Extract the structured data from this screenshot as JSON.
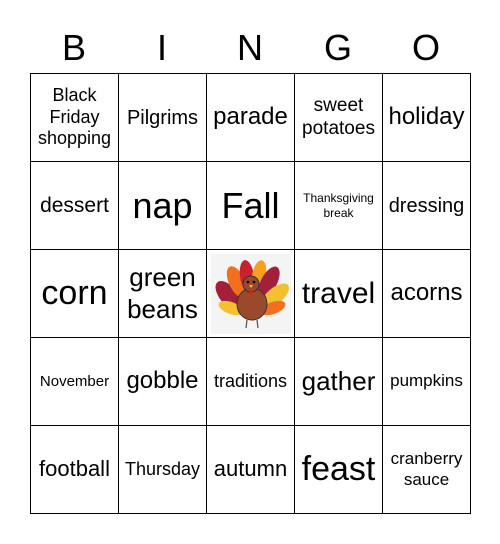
{
  "header": [
    "B",
    "I",
    "N",
    "G",
    "O"
  ],
  "cells": [
    {
      "text": "Black Friday shopping",
      "size": 18
    },
    {
      "text": "Pilgrims",
      "size": 20
    },
    {
      "text": "parade",
      "size": 24
    },
    {
      "text": "sweet potatoes",
      "size": 19
    },
    {
      "text": "holiday",
      "size": 24
    },
    {
      "text": "dessert",
      "size": 21
    },
    {
      "text": "nap",
      "size": 36
    },
    {
      "text": "Fall",
      "size": 36
    },
    {
      "text": "Thanksgiving break",
      "size": 12
    },
    {
      "text": "dressing",
      "size": 20
    },
    {
      "text": "corn",
      "size": 34
    },
    {
      "text": "green beans",
      "size": 26
    },
    {
      "text": "",
      "free": true,
      "icon": "turkey-icon"
    },
    {
      "text": "travel",
      "size": 30
    },
    {
      "text": "acorns",
      "size": 24
    },
    {
      "text": "November",
      "size": 15
    },
    {
      "text": "gobble",
      "size": 24
    },
    {
      "text": "traditions",
      "size": 18
    },
    {
      "text": "gather",
      "size": 26
    },
    {
      "text": "pumpkins",
      "size": 17
    },
    {
      "text": "football",
      "size": 22
    },
    {
      "text": "Thursday",
      "size": 18
    },
    {
      "text": "autumn",
      "size": 22
    },
    {
      "text": "feast",
      "size": 34
    },
    {
      "text": "cranberry sauce",
      "size": 17
    }
  ]
}
